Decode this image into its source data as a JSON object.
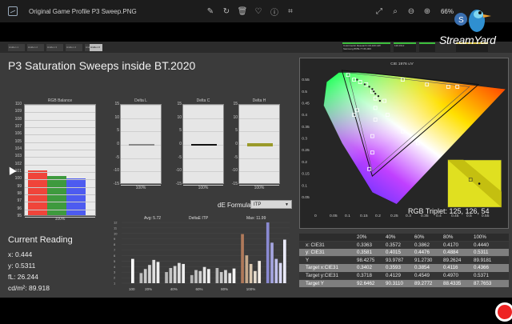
{
  "viewer": {
    "title": "Original Game Profile P3 Sweep.PNG",
    "zoom": "66%",
    "tools": [
      "edit-image-icon",
      "rotate-icon",
      "delete-icon",
      "favorite-icon",
      "info-icon",
      "crop-icon"
    ],
    "right_tools": [
      "fullscreen-icon",
      "search-icon",
      "zoom-out-icon",
      "zoom-in-icon"
    ]
  },
  "app": {
    "tabs": [
      "Hidden 1",
      "Hidden 2",
      "Hidden 3",
      "Hidden 4",
      "Hidden 5",
      "Hidden 6"
    ],
    "active_tab_index": 5,
    "device_box_1": "Colorimetric Research CR-100 HW\nSamsung 8659-77-66-000",
    "device_box_2": "120.15nz",
    "accent_green": "#3cbe3c",
    "accent_yellow": "#d8c24a"
  },
  "page_title": "P3 Saturation Sweeps inside BT.2020",
  "rgb_balance": {
    "title": "RGB Balance",
    "y_ticks": [
      "110",
      "109",
      "108",
      "107",
      "106",
      "105",
      "104",
      "103",
      "102",
      "101",
      "100",
      "99",
      "98",
      "97",
      "96",
      "95"
    ],
    "x_label": "100%",
    "values": {
      "r": 101,
      "g": 100.2,
      "b": 99.9
    },
    "ymin": 95,
    "ymax": 110,
    "colors": {
      "r": "#f0443a",
      "g": "#3e9a3e",
      "b": "#4d5bf0"
    }
  },
  "delta_charts": [
    {
      "title": "Delta L",
      "x_label": "100%",
      "value": 0,
      "color": "#888"
    },
    {
      "title": "Delta C",
      "x_label": "100%",
      "value": 0,
      "color": "#111"
    },
    {
      "title": "Delta H",
      "x_label": "100%",
      "value": 0,
      "color": "#9a9a2a"
    }
  ],
  "delta_ticks": [
    "15",
    "10",
    "5",
    "0",
    "-5",
    "-10",
    "-15"
  ],
  "de_formula": {
    "label": "dE Formula:",
    "value": "ITP"
  },
  "current_reading": {
    "title": "Current Reading",
    "x": "x: 0.444",
    "y": "y: 0.5311",
    "fl": "fL: 26.244",
    "cdm2": "cd/m²: 89.918"
  },
  "delta_itp": {
    "avg": "Avg: 5.72",
    "title": "DeltaE ITP",
    "max": "Max: 11.99",
    "y_ticks": [
      "12",
      "11",
      "10",
      "9",
      "8",
      "7",
      "6",
      "5",
      "4",
      "3",
      "2",
      "1"
    ],
    "x_labels": [
      "100",
      "20%",
      "40%",
      "60%",
      "80%",
      "100%"
    ],
    "bars": [
      {
        "v": 4.8,
        "c": "#ffffff"
      },
      {
        "v": 2.0,
        "c": "#bdbdbd"
      },
      {
        "v": 2.8,
        "c": "#c9c9c9"
      },
      {
        "v": 3.6,
        "c": "#d5d5d5"
      },
      {
        "v": 4.6,
        "c": "#e0e0e0"
      },
      {
        "v": 4.2,
        "c": "#f0f0f0"
      },
      {
        "v": 2.2,
        "c": "#b7b7b7"
      },
      {
        "v": 3.0,
        "c": "#c6c6c6"
      },
      {
        "v": 3.4,
        "c": "#d3d3d3"
      },
      {
        "v": 4.0,
        "c": "#dfdfdf"
      },
      {
        "v": 3.8,
        "c": "#eeeeee"
      },
      {
        "v": 1.6,
        "c": "#b5b5b5"
      },
      {
        "v": 2.6,
        "c": "#c3c3c3"
      },
      {
        "v": 2.4,
        "c": "#d2d2d2"
      },
      {
        "v": 3.2,
        "c": "#e3e3e3"
      },
      {
        "v": 2.8,
        "c": "#f1f1f1"
      },
      {
        "v": 3.0,
        "c": "#b9b9b9"
      },
      {
        "v": 2.2,
        "c": "#c8c8c8"
      },
      {
        "v": 2.6,
        "c": "#d8d8d8"
      },
      {
        "v": 2.0,
        "c": "#e8e8e8"
      },
      {
        "v": 2.9,
        "c": "#f5f5f5"
      },
      {
        "v": 9.7,
        "c": "#b07a5a"
      },
      {
        "v": 5.5,
        "c": "#c7a98a"
      },
      {
        "v": 3.8,
        "c": "#dcc9b0"
      },
      {
        "v": 2.4,
        "c": "#e6ddcf"
      },
      {
        "v": 4.4,
        "c": "#f4eee6"
      },
      {
        "v": 11.99,
        "c": "#8a8ad2"
      },
      {
        "v": 8.0,
        "c": "#a5a5e0"
      },
      {
        "v": 4.8,
        "c": "#c0c0ec"
      },
      {
        "v": 4.0,
        "c": "#d8d8f5"
      },
      {
        "v": 8.6,
        "c": "#ebebfa"
      }
    ]
  },
  "cie": {
    "title": "CIE 1976 u'v'",
    "rgb_triplet": "RGB Triplet: 125, 126, 54",
    "u_ticks": [
      "0",
      "0.05",
      "0.1",
      "0.15",
      "0.2",
      "0.25",
      "0.3",
      "0.35",
      "0.4",
      "0.45",
      "0.5",
      "0.55"
    ],
    "v_ticks": [
      "0.55",
      "0.5",
      "0.45",
      "0.4",
      "0.35",
      "0.3",
      "0.25",
      "0.2",
      "0.15",
      "0.1",
      "0.05"
    ]
  },
  "table": {
    "headers": [
      "",
      "20%",
      "40%",
      "60%",
      "80%",
      "100%"
    ],
    "rows": [
      {
        "label": "x: CIE31",
        "values": [
          "0.3363",
          "0.3572",
          "0.3862",
          "0.4170",
          "0.4440"
        ],
        "style": "dark"
      },
      {
        "label": "y: CIE31",
        "values": [
          "0.3581",
          "0.4015",
          "0.4476",
          "0.4884",
          "0.5311"
        ],
        "style": "lite"
      },
      {
        "label": "Y",
        "values": [
          "98.4275",
          "93.9787",
          "91.2730",
          "89.2624",
          "89.9181"
        ],
        "style": "dark"
      },
      {
        "label": "Target x:CIE31",
        "values": [
          "0.3402",
          "0.3593",
          "0.3854",
          "0.4116",
          "0.4366"
        ],
        "style": "lite"
      },
      {
        "label": "Target y:CIE31",
        "values": [
          "0.3718",
          "0.4129",
          "0.4549",
          "0.4970",
          "0.5371"
        ],
        "style": "dark"
      },
      {
        "label": "Target Y",
        "values": [
          "92.6462",
          "90.3110",
          "89.2772",
          "88.4335",
          "87.7653"
        ],
        "style": "lite"
      }
    ]
  },
  "overlay": {
    "brand": "StreamYard"
  }
}
